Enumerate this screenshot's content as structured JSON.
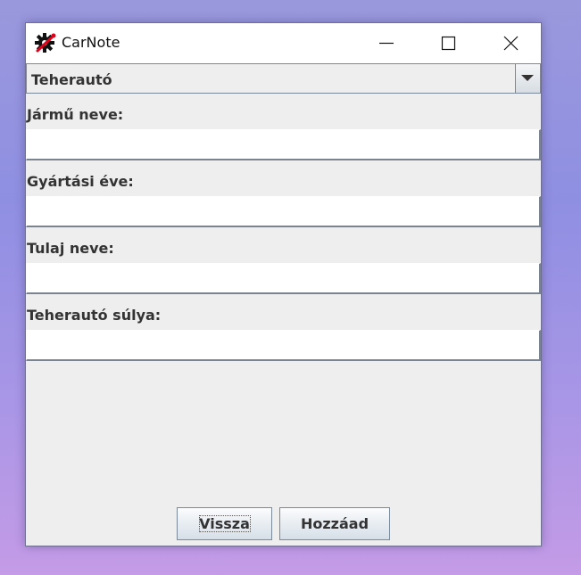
{
  "window": {
    "title": "CarNote",
    "icon": "gear-wrench-icon"
  },
  "titlebar_buttons": {
    "minimize_icon": "minimize-icon",
    "maximize_icon": "maximize-icon",
    "close_icon": "close-icon"
  },
  "vehicle_type": {
    "selected": "Teherautó",
    "arrow_icon": "chevron-down-icon"
  },
  "fields": [
    {
      "label": "Jármű neve:",
      "value": ""
    },
    {
      "label": "Gyártási éve:",
      "value": ""
    },
    {
      "label": "Tulaj neve:",
      "value": ""
    },
    {
      "label": "Teherautó súlya:",
      "value": ""
    }
  ],
  "buttons": {
    "back_label": "Vissza",
    "add_label": "Hozzáad"
  },
  "colors": {
    "app_icon_accent": "#e0001a",
    "window_background": "#eeeeee"
  }
}
